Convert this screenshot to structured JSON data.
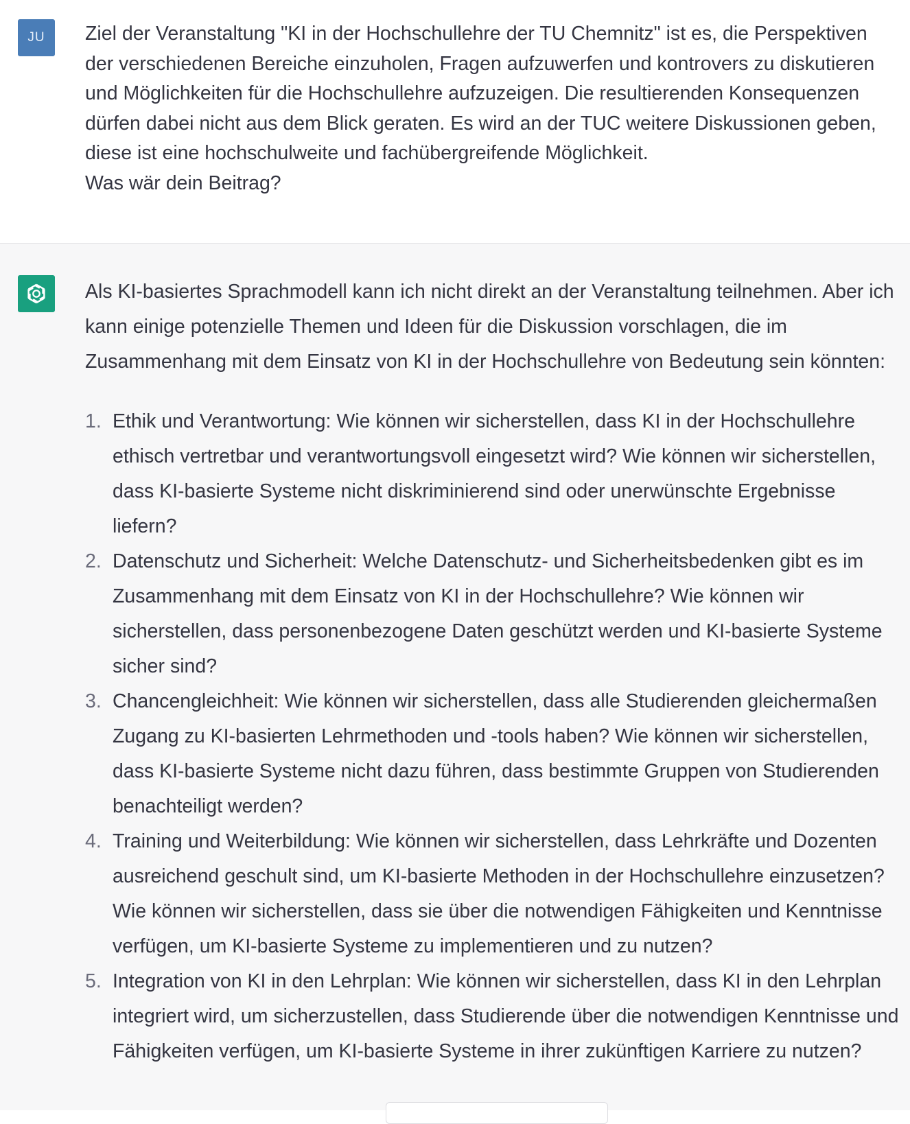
{
  "user": {
    "avatar_initials": "JU",
    "message_lines": [
      "Ziel der Veranstaltung \"KI in der Hochschullehre der TU Chemnitz\" ist es, die Perspektiven",
      "der verschiedenen Bereiche einzuholen, Fragen aufzuwerfen und kontrovers zu diskutieren",
      "und Möglichkeiten für die Hochschullehre aufzuzeigen. Die resultierenden Konsequenzen",
      "dürfen dabei nicht aus dem Blick geraten. Es wird an der TUC weitere Diskussionen geben,",
      "diese ist eine hochschulweite und fachübergreifende Möglichkeit.",
      "Was wär dein Beitrag?"
    ]
  },
  "assistant": {
    "avatar_icon": "openai-logo-icon",
    "intro": "Als KI-basiertes Sprachmodell kann ich nicht direkt an der Veranstaltung teilnehmen. Aber ich kann einige potenzielle Themen und Ideen für die Diskussion vorschlagen, die im Zusammenhang mit dem Einsatz von KI in der Hochschullehre von Bedeutung sein könnten:",
    "items": [
      {
        "number": "1.",
        "text": "Ethik und Verantwortung: Wie können wir sicherstellen, dass KI in der Hochschullehre ethisch vertretbar und verantwortungsvoll eingesetzt wird? Wie können wir sicherstellen, dass KI-basierte Systeme nicht diskriminierend sind oder unerwünschte Ergebnisse liefern?"
      },
      {
        "number": "2.",
        "text": "Datenschutz und Sicherheit: Welche Datenschutz- und Sicherheitsbedenken gibt es im Zusammenhang mit dem Einsatz von KI in der Hochschullehre? Wie können wir sicherstellen, dass personenbezogene Daten geschützt werden und KI-basierte Systeme sicher sind?"
      },
      {
        "number": "3.",
        "text": "Chancengleichheit: Wie können wir sicherstellen, dass alle Studierenden gleichermaßen Zugang zu KI-basierten Lehrmethoden und -tools haben? Wie können wir sicherstellen, dass KI-basierte Systeme nicht dazu führen, dass bestimmte Gruppen von Studierenden benachteiligt werden?"
      },
      {
        "number": "4.",
        "text": "Training und Weiterbildung: Wie können wir sicherstellen, dass Lehrkräfte und Dozenten ausreichend geschult sind, um KI-basierte Methoden in der Hochschullehre einzusetzen? Wie können wir sicherstellen, dass sie über die notwendigen Fähigkeiten und Kenntnisse verfügen, um KI-basierte Systeme zu implementieren und zu nutzen?"
      },
      {
        "number": "5.",
        "text": "Integration von KI in den Lehrplan: Wie können wir sicherstellen, dass KI in den Lehrplan integriert wird, um sicherzustellen, dass Studierende über die notwendigen Kenntnisse und Fähigkeiten verfügen, um KI-basierte Systeme in ihrer zukünftigen Karriere zu nutzen?"
      }
    ]
  },
  "colors": {
    "user_avatar_bg": "#4a7db7",
    "bot_avatar_bg": "#19a07f",
    "assistant_bg": "#f7f7f8",
    "text": "#343541"
  }
}
